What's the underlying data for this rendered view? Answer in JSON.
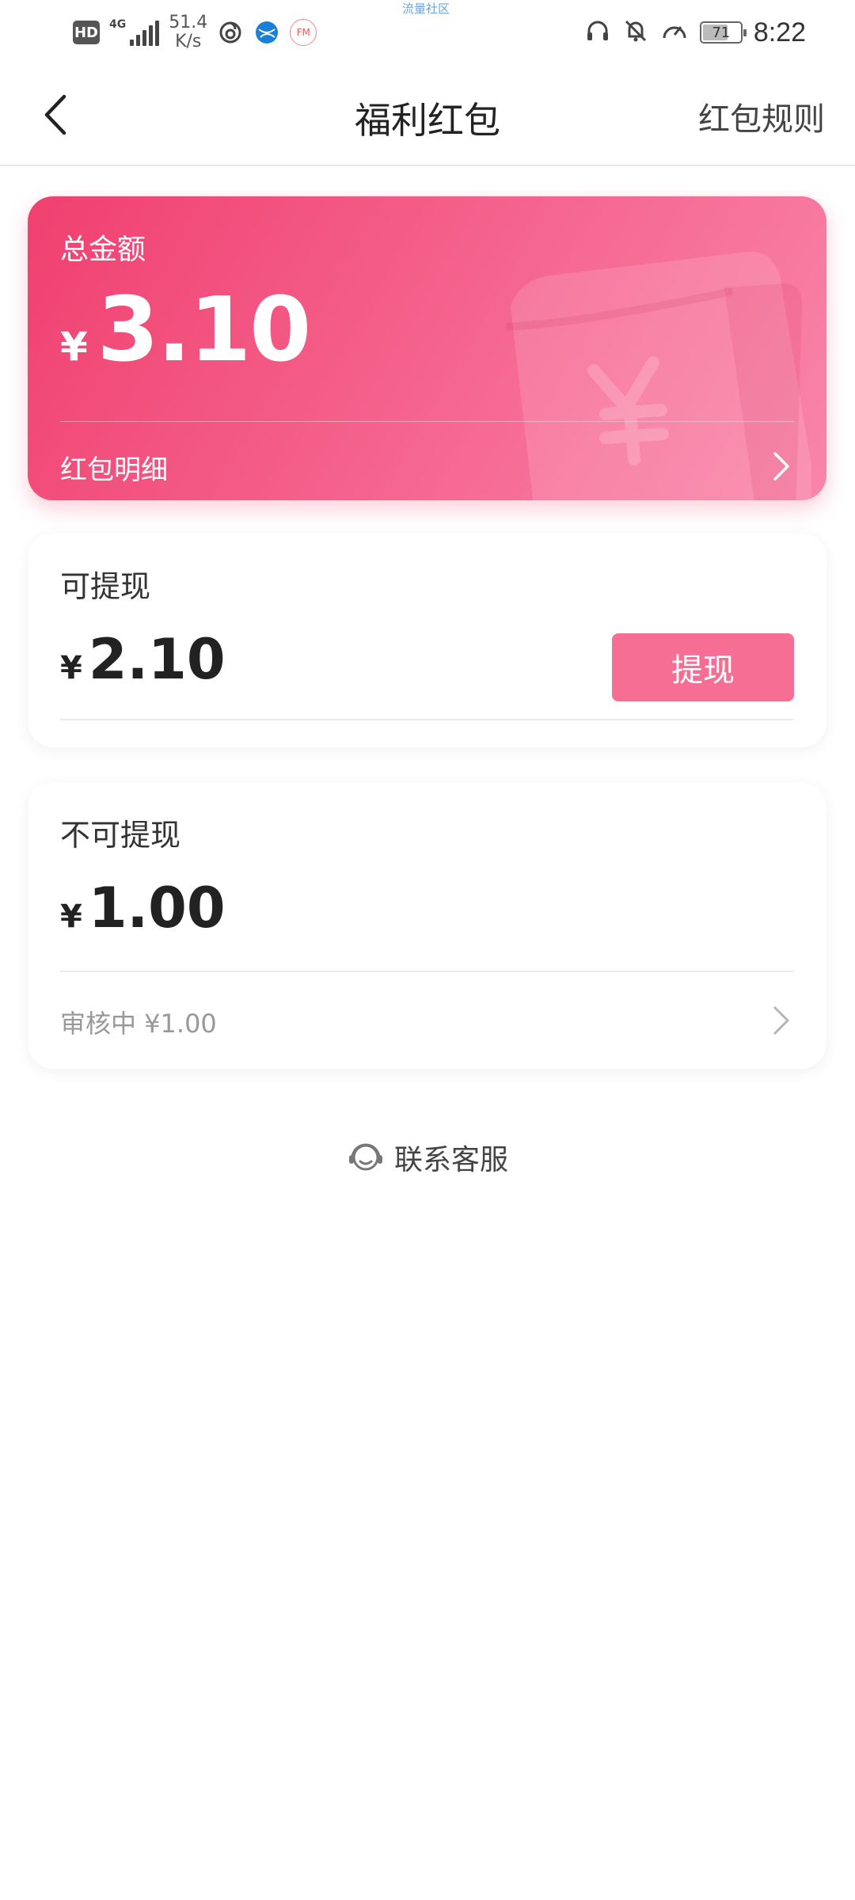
{
  "status_bar": {
    "hd_label": "HD",
    "network_label": "4G",
    "net_speed_value": "51.4",
    "net_speed_unit": "K/s",
    "center_text": "流量社区",
    "battery_percent": 71,
    "battery_label": "71",
    "time": "8:22",
    "fm_label": "FM",
    "icons": [
      "hd-icon",
      "signal-icon",
      "netease-music-icon",
      "browser-icon",
      "fm-radio-icon",
      "headphones-icon",
      "bell-off-icon",
      "speedometer-icon",
      "battery-icon"
    ]
  },
  "nav": {
    "title": "福利红包",
    "rules_label": "红包规则",
    "back_icon": "chevron-left-icon"
  },
  "total_card": {
    "label": "总金额",
    "currency": "¥",
    "amount": "3.10",
    "detail_label": "红包明细",
    "accent_start": "#f04070",
    "accent_end": "#f985aa"
  },
  "withdrawable_card": {
    "label": "可提现",
    "currency": "¥",
    "amount": "2.10",
    "button_label": "提现",
    "button_color": "#f76e94"
  },
  "non_withdrawable_card": {
    "label": "不可提现",
    "currency": "¥",
    "amount": "1.00",
    "review_text": "审核中 ¥1.00"
  },
  "support": {
    "label": "联系客服",
    "icon": "customer-service-icon"
  }
}
